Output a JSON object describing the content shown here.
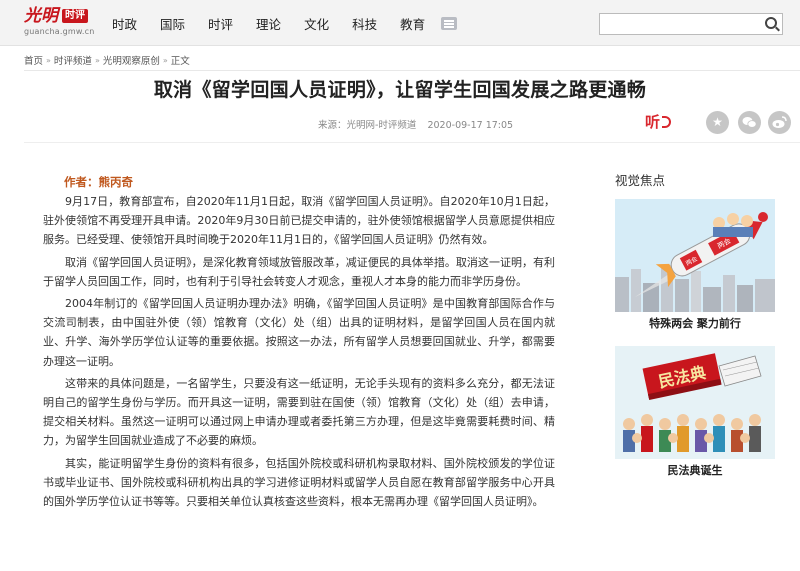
{
  "header": {
    "logo_brand": "光明",
    "logo_badge": "时评",
    "logo_domain": "guancha.gmw.cn",
    "nav": [
      "时政",
      "国际",
      "时评",
      "理论",
      "文化",
      "科技",
      "教育"
    ],
    "search_value": "",
    "search_placeholder": ""
  },
  "breadcrumb": [
    "首页",
    "时评频道",
    "光明观察原创",
    "正文"
  ],
  "article": {
    "title": "取消《留学回国人员证明》，让留学生回国发展之路更通畅",
    "source": "来源：光明网-时评频道",
    "datetime": "2020-09-17 17:05",
    "listen_label": "听",
    "author": "作者：熊丙奇",
    "paragraphs": [
      "9月17日，教育部宣布，自2020年11月1日起，取消《留学回国人员证明》。自2020年10月1日起，驻外使领馆不再受理开具申请。2020年9月30日前已提交申请的，驻外使领馆根据留学人员意愿提供相应服务。已经受理、使领馆开具时间晚于2020年11月1日的，《留学回国人员证明》仍然有效。",
      "取消《留学回国人员证明》，是深化教育领域放管服改革，减证便民的具体举措。取消这一证明，有利于留学人员回国工作，同时，也有利于引导社会转变人才观念，重视人才本身的能力而非学历身份。",
      "2004年制订的《留学回国人员证明办理办法》明确，《留学回国人员证明》是中国教育部国际合作与交流司制表，由中国驻外使（领）馆教育（文化）处（组）出具的证明材料，是留学回国人员在国内就业、升学、海外学历学位认证等的重要依据。按照这一办法，所有留学人员想要回国就业、升学，都需要办理这一证明。",
      "这带来的具体问题是，一名留学生，只要没有这一纸证明，无论手头现有的资料多么充分，都无法证明自己的留学生身份与学历。而开具这一证明，需要到驻在国使（领）馆教育（文化）处（组）去申请，提交相关材料。虽然这一证明可以通过网上申请办理或者委托第三方办理，但是这毕竟需要耗费时间、精力，为留学生回国就业造成了不必要的麻烦。",
      "其实，能证明留学生身份的资料有很多，包括国外院校或科研机构录取材料、国外院校颁发的学位证书或毕业证书、国外院校或科研机构出具的学习进修证明材料或留学人员自愿在教育部留学服务中心开具的国外学历学位认证书等等。只要相关单位认真核查这些资料，根本无需再办理《留学回国人员证明》。"
    ]
  },
  "sidebar": {
    "title": "视觉焦点",
    "cards": [
      {
        "caption": "特殊两会 聚力前行",
        "banner_text": "两会",
        "badge_text": "两会"
      },
      {
        "caption": "民法典诞生",
        "banner_text": "民法典"
      }
    ]
  },
  "colors": {
    "brand_red": "#c8161d",
    "author_orange": "#c0591f",
    "share_gray": "#c6c6c6"
  },
  "icons": [
    "menu-icon",
    "search-icon",
    "listen-icon",
    "star-icon",
    "wechat-icon",
    "weibo-icon"
  ]
}
